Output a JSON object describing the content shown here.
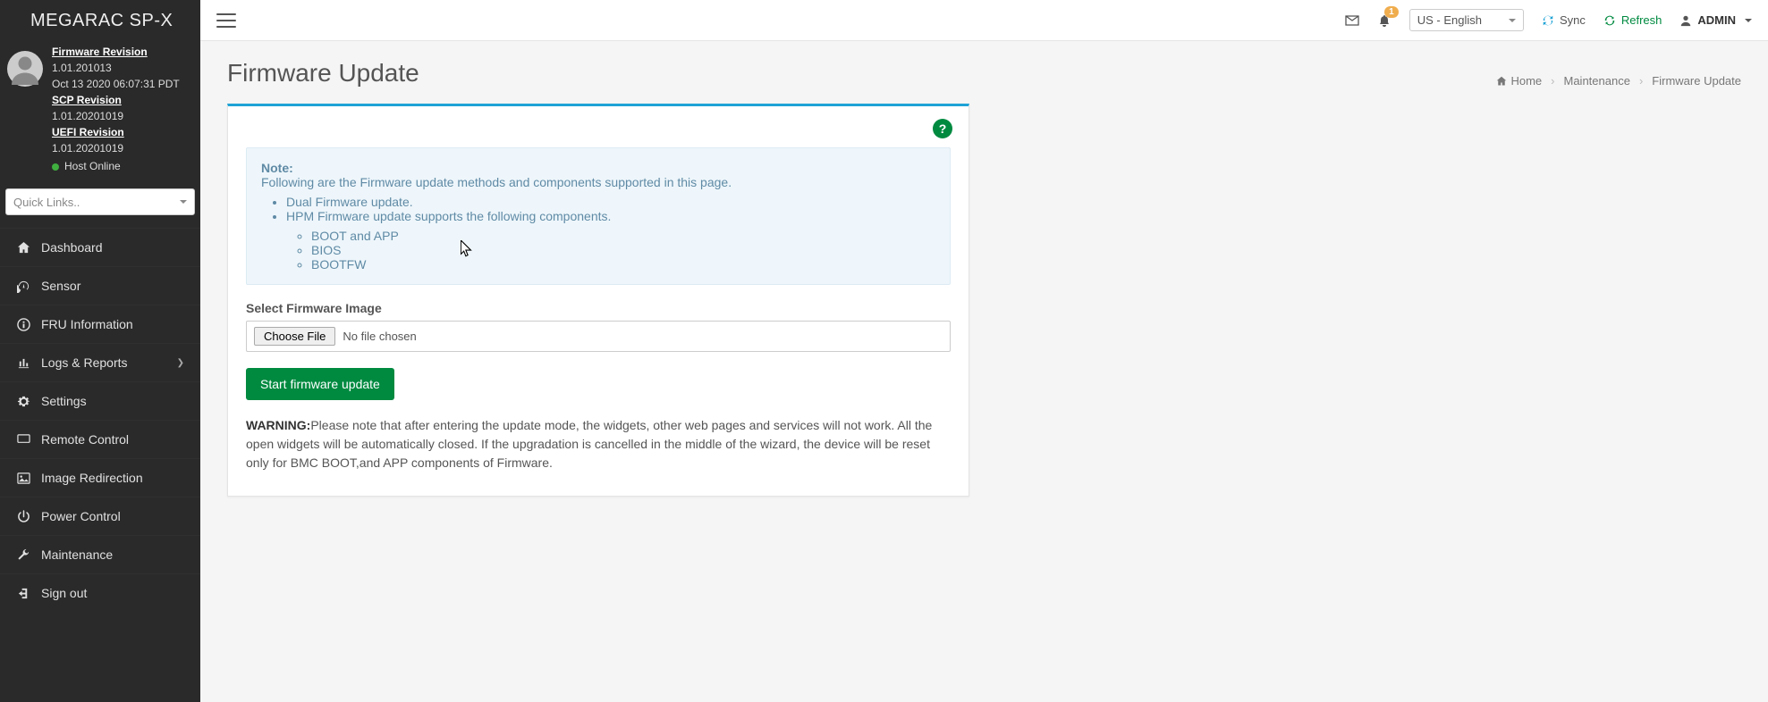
{
  "brand": "MEGARAC SP-X",
  "user": {
    "fw_rev_label": "Firmware Revision",
    "fw_rev": "1.01.201013",
    "fw_date": "Oct 13 2020 06:07:31 PDT",
    "scp_rev_label": "SCP Revision",
    "scp_rev": "1.01.20201019",
    "uefi_rev_label": "UEFI Revision",
    "uefi_rev": "1.01.20201019",
    "host_status": "Host Online"
  },
  "quicklinks": {
    "placeholder": "Quick Links.."
  },
  "nav": [
    {
      "icon": "home",
      "label": "Dashboard"
    },
    {
      "icon": "dashboard",
      "label": "Sensor"
    },
    {
      "icon": "info",
      "label": "FRU Information"
    },
    {
      "icon": "chart",
      "label": "Logs & Reports",
      "has_sub": true
    },
    {
      "icon": "gear",
      "label": "Settings"
    },
    {
      "icon": "monitor",
      "label": "Remote Control"
    },
    {
      "icon": "image",
      "label": "Image Redirection"
    },
    {
      "icon": "power",
      "label": "Power Control"
    },
    {
      "icon": "wrench",
      "label": "Maintenance"
    },
    {
      "icon": "signout",
      "label": "Sign out"
    }
  ],
  "topbar": {
    "notification_count": "1",
    "language": "US - English",
    "sync": "Sync",
    "refresh": "Refresh",
    "admin": "ADMIN"
  },
  "page": {
    "title": "Firmware Update",
    "breadcrumb": {
      "home": "Home",
      "mid": "Maintenance",
      "last": "Firmware Update"
    }
  },
  "note": {
    "heading": "Note:",
    "line": "Following are the Firmware update methods and components supported in this page.",
    "b1": "Dual Firmware update.",
    "b2": "HPM Firmware update supports the following components.",
    "s1": "BOOT and APP",
    "s2": "BIOS",
    "s3": "BOOTFW"
  },
  "form": {
    "label": "Select Firmware Image",
    "choose": "Choose File",
    "nofile": "No file chosen",
    "start": "Start firmware update"
  },
  "warning": {
    "label": "WARNING:",
    "text": "Please note that after entering the update mode, the widgets, other web pages and services will not work. All the open widgets will be automatically closed. If the upgradation is cancelled in the middle of the wizard, the device will be reset only for BMC BOOT,and APP components of Firmware."
  }
}
